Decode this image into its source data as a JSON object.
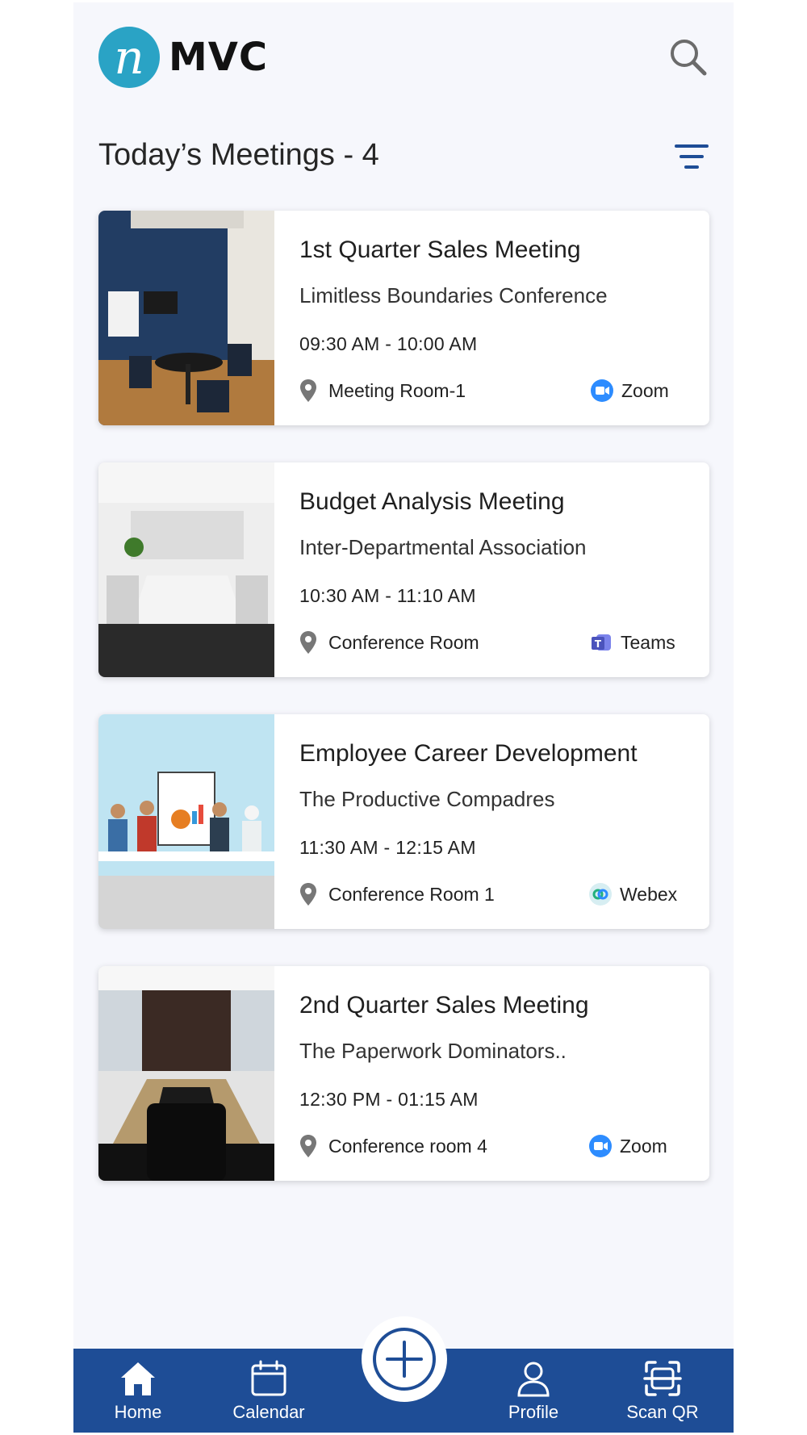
{
  "app": {
    "logo_letter": "n",
    "logo_text": "MVC"
  },
  "header": {
    "title": "Today’s Meetings - 4"
  },
  "meetings": [
    {
      "title": "1st Quarter Sales Meeting",
      "organization": "Limitless Boundaries Conference",
      "time": "09:30 AM - 10:00 AM",
      "location": "Meeting Room-1",
      "platform": "Zoom",
      "platform_icon": "zoom-icon"
    },
    {
      "title": "Budget Analysis Meeting",
      "organization": "Inter-Departmental Association",
      "time": "10:30 AM - 11:10 AM",
      "location": "Conference Room",
      "platform": "Teams",
      "platform_icon": "teams-icon"
    },
    {
      "title": "Employee Career Development",
      "organization": "The Productive Compadres",
      "time": "11:30 AM - 12:15 AM",
      "location": "Conference Room 1",
      "platform": "Webex",
      "platform_icon": "webex-icon"
    },
    {
      "title": "2nd Quarter Sales Meeting",
      "organization": "The Paperwork Dominators..",
      "time": "12:30 PM - 01:15 AM",
      "location": "Conference room 4",
      "platform": "Zoom",
      "platform_icon": "zoom-icon"
    }
  ],
  "nav": {
    "home": "Home",
    "calendar": "Calendar",
    "profile": "Profile",
    "scan_qr": "Scan QR"
  },
  "colors": {
    "brand_blue": "#1e4d96",
    "logo_teal": "#2aa3c5",
    "zoom_blue": "#2d8cff",
    "teams_blue": "#4b53bc",
    "background": "#f6f7fc"
  }
}
